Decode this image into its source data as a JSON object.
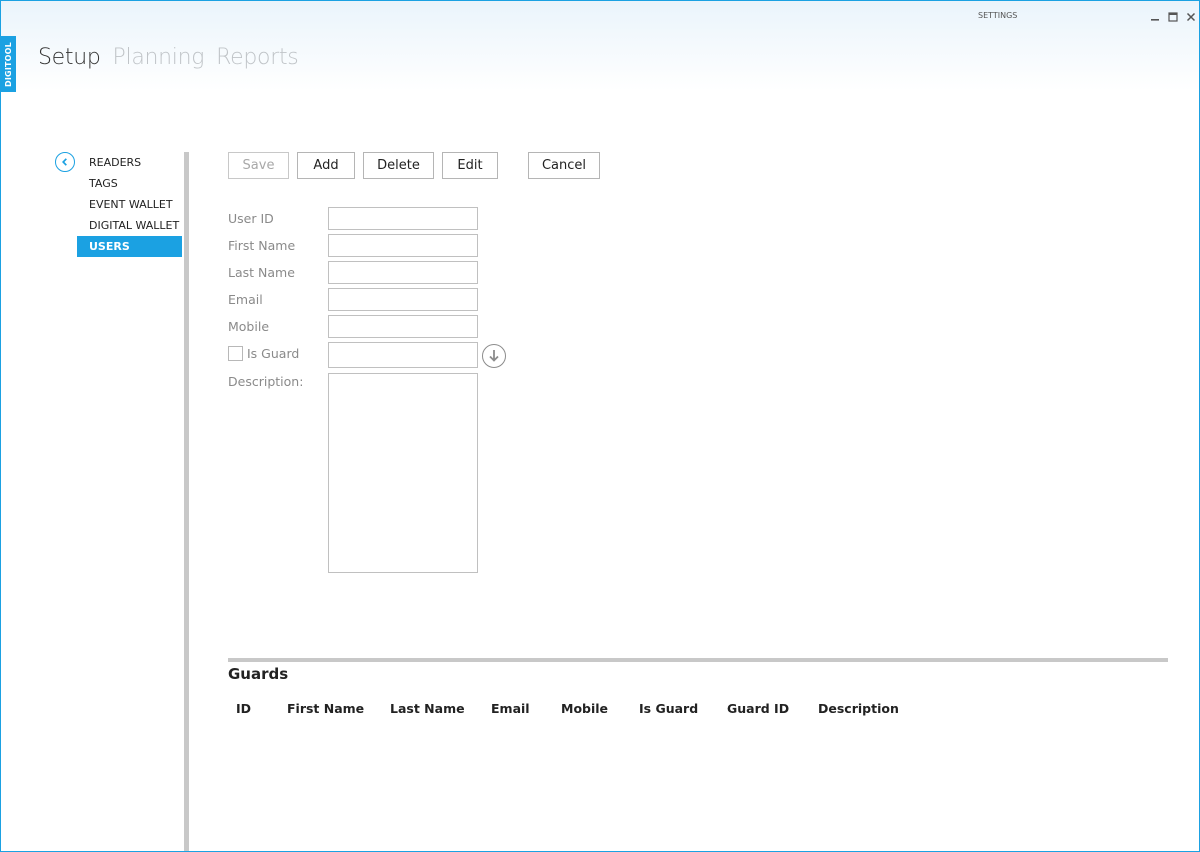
{
  "app": {
    "tag": "DIGITOOL",
    "window_title": "SETTINGS"
  },
  "nav": {
    "setup": "Setup",
    "planning": "Planning",
    "reports": "Reports"
  },
  "sidebar": {
    "items": [
      {
        "label": "READERS"
      },
      {
        "label": "TAGS"
      },
      {
        "label": "EVENT WALLET"
      },
      {
        "label": "DIGITAL WALLET"
      },
      {
        "label": "USERS",
        "selected": true
      }
    ]
  },
  "toolbar": {
    "save_label": "Save",
    "add_label": "Add",
    "delete_label": "Delete",
    "edit_label": "Edit",
    "cancel_label": "Cancel"
  },
  "form": {
    "user_id_label": "User ID",
    "first_name_label": "First Name",
    "last_name_label": "Last Name",
    "email_label": "Email",
    "mobile_label": "Mobile",
    "is_guard_label": "Is Guard",
    "description_label": "Description:",
    "user_id": "",
    "first_name": "",
    "last_name": "",
    "email": "",
    "mobile": "",
    "guard_id": "",
    "description": "",
    "is_guard_checked": false
  },
  "grid": {
    "title": "Guards",
    "columns": [
      "ID",
      "First Name",
      "Last Name",
      "Email",
      "Mobile",
      "Is Guard",
      "Guard ID",
      "Description"
    ],
    "rows": []
  },
  "colors": {
    "accent": "#1ba1e2",
    "divider": "#c8c8c8"
  },
  "icons": {
    "back": "chevron-left-circle-icon",
    "download": "arrow-down-circle-icon"
  }
}
